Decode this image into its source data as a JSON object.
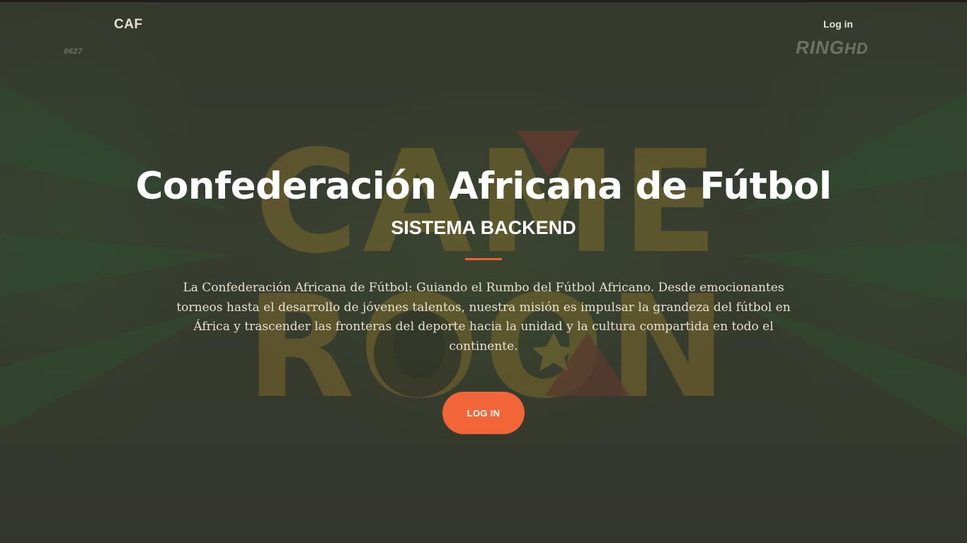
{
  "navbar": {
    "brand": "CAF",
    "login_link": "Log in"
  },
  "watermark": {
    "channel_main": "RING",
    "channel_suffix": "HD",
    "corner_code": "0627"
  },
  "hero": {
    "title": "Confederación Africana de Fútbol",
    "subtitle": "SISTEMA BACKEND",
    "description": "La Confederación Africana de Fútbol: Guiando el Rumbo del Fútbol Africano. Desde emocionantes torneos hasta el desarrollo de jóvenes talentos, nuestra misión es impulsar la grandeza del fútbol en África y trascender las fronteras del deporte hacia la unidad y la cultura compartida en todo el continente.",
    "cta_label": "LOG IN",
    "background_art_text_line1": "CAME",
    "background_art_text_line2": "ROON"
  },
  "colors": {
    "accent": "#f26539",
    "art_yellow": "#b98f2c",
    "art_red": "#9c3a35",
    "text_light": "#e8e1d2"
  }
}
